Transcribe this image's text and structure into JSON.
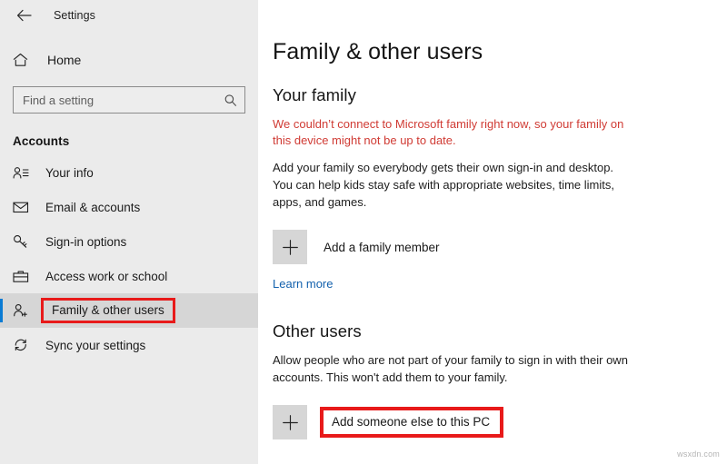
{
  "window": {
    "app_title": "Settings",
    "back_icon": "back-arrow-icon"
  },
  "sidebar": {
    "home": {
      "label": "Home",
      "icon": "home-icon"
    },
    "search": {
      "placeholder": "Find a setting",
      "value": "",
      "icon": "search-icon"
    },
    "category": "Accounts",
    "items": [
      {
        "label": "Your info",
        "icon": "user-info-icon",
        "selected": false
      },
      {
        "label": "Email & accounts",
        "icon": "envelope-icon",
        "selected": false
      },
      {
        "label": "Sign-in options",
        "icon": "key-icon",
        "selected": false
      },
      {
        "label": "Access work or school",
        "icon": "briefcase-icon",
        "selected": false
      },
      {
        "label": "Family & other users",
        "icon": "user-add-icon",
        "selected": true
      },
      {
        "label": "Sync your settings",
        "icon": "sync-icon",
        "selected": false
      }
    ]
  },
  "main": {
    "page_title": "Family & other users",
    "your_family": {
      "heading": "Your family",
      "error": "We couldn’t connect to Microsoft family right now, so your family on this device might not be up to date.",
      "description": "Add your family so everybody gets their own sign-in and desktop. You can help kids stay safe with appropriate websites, time limits, apps, and games.",
      "add_button": "Add a family member",
      "learn_more": "Learn more"
    },
    "other_users": {
      "heading": "Other users",
      "description": "Allow people who are not part of your family to sign in with their own accounts. This won't add them to your family.",
      "add_button": "Add someone else to this PC"
    }
  },
  "watermark": "wsxdn.com",
  "colors": {
    "accent_blue": "#0a7bd4",
    "highlight_red": "#e81a1a",
    "error_red": "#d03b34",
    "link_blue": "#1361ad",
    "sidebar_bg": "#ebebeb",
    "selected_row_bg": "#d6d6d6"
  }
}
